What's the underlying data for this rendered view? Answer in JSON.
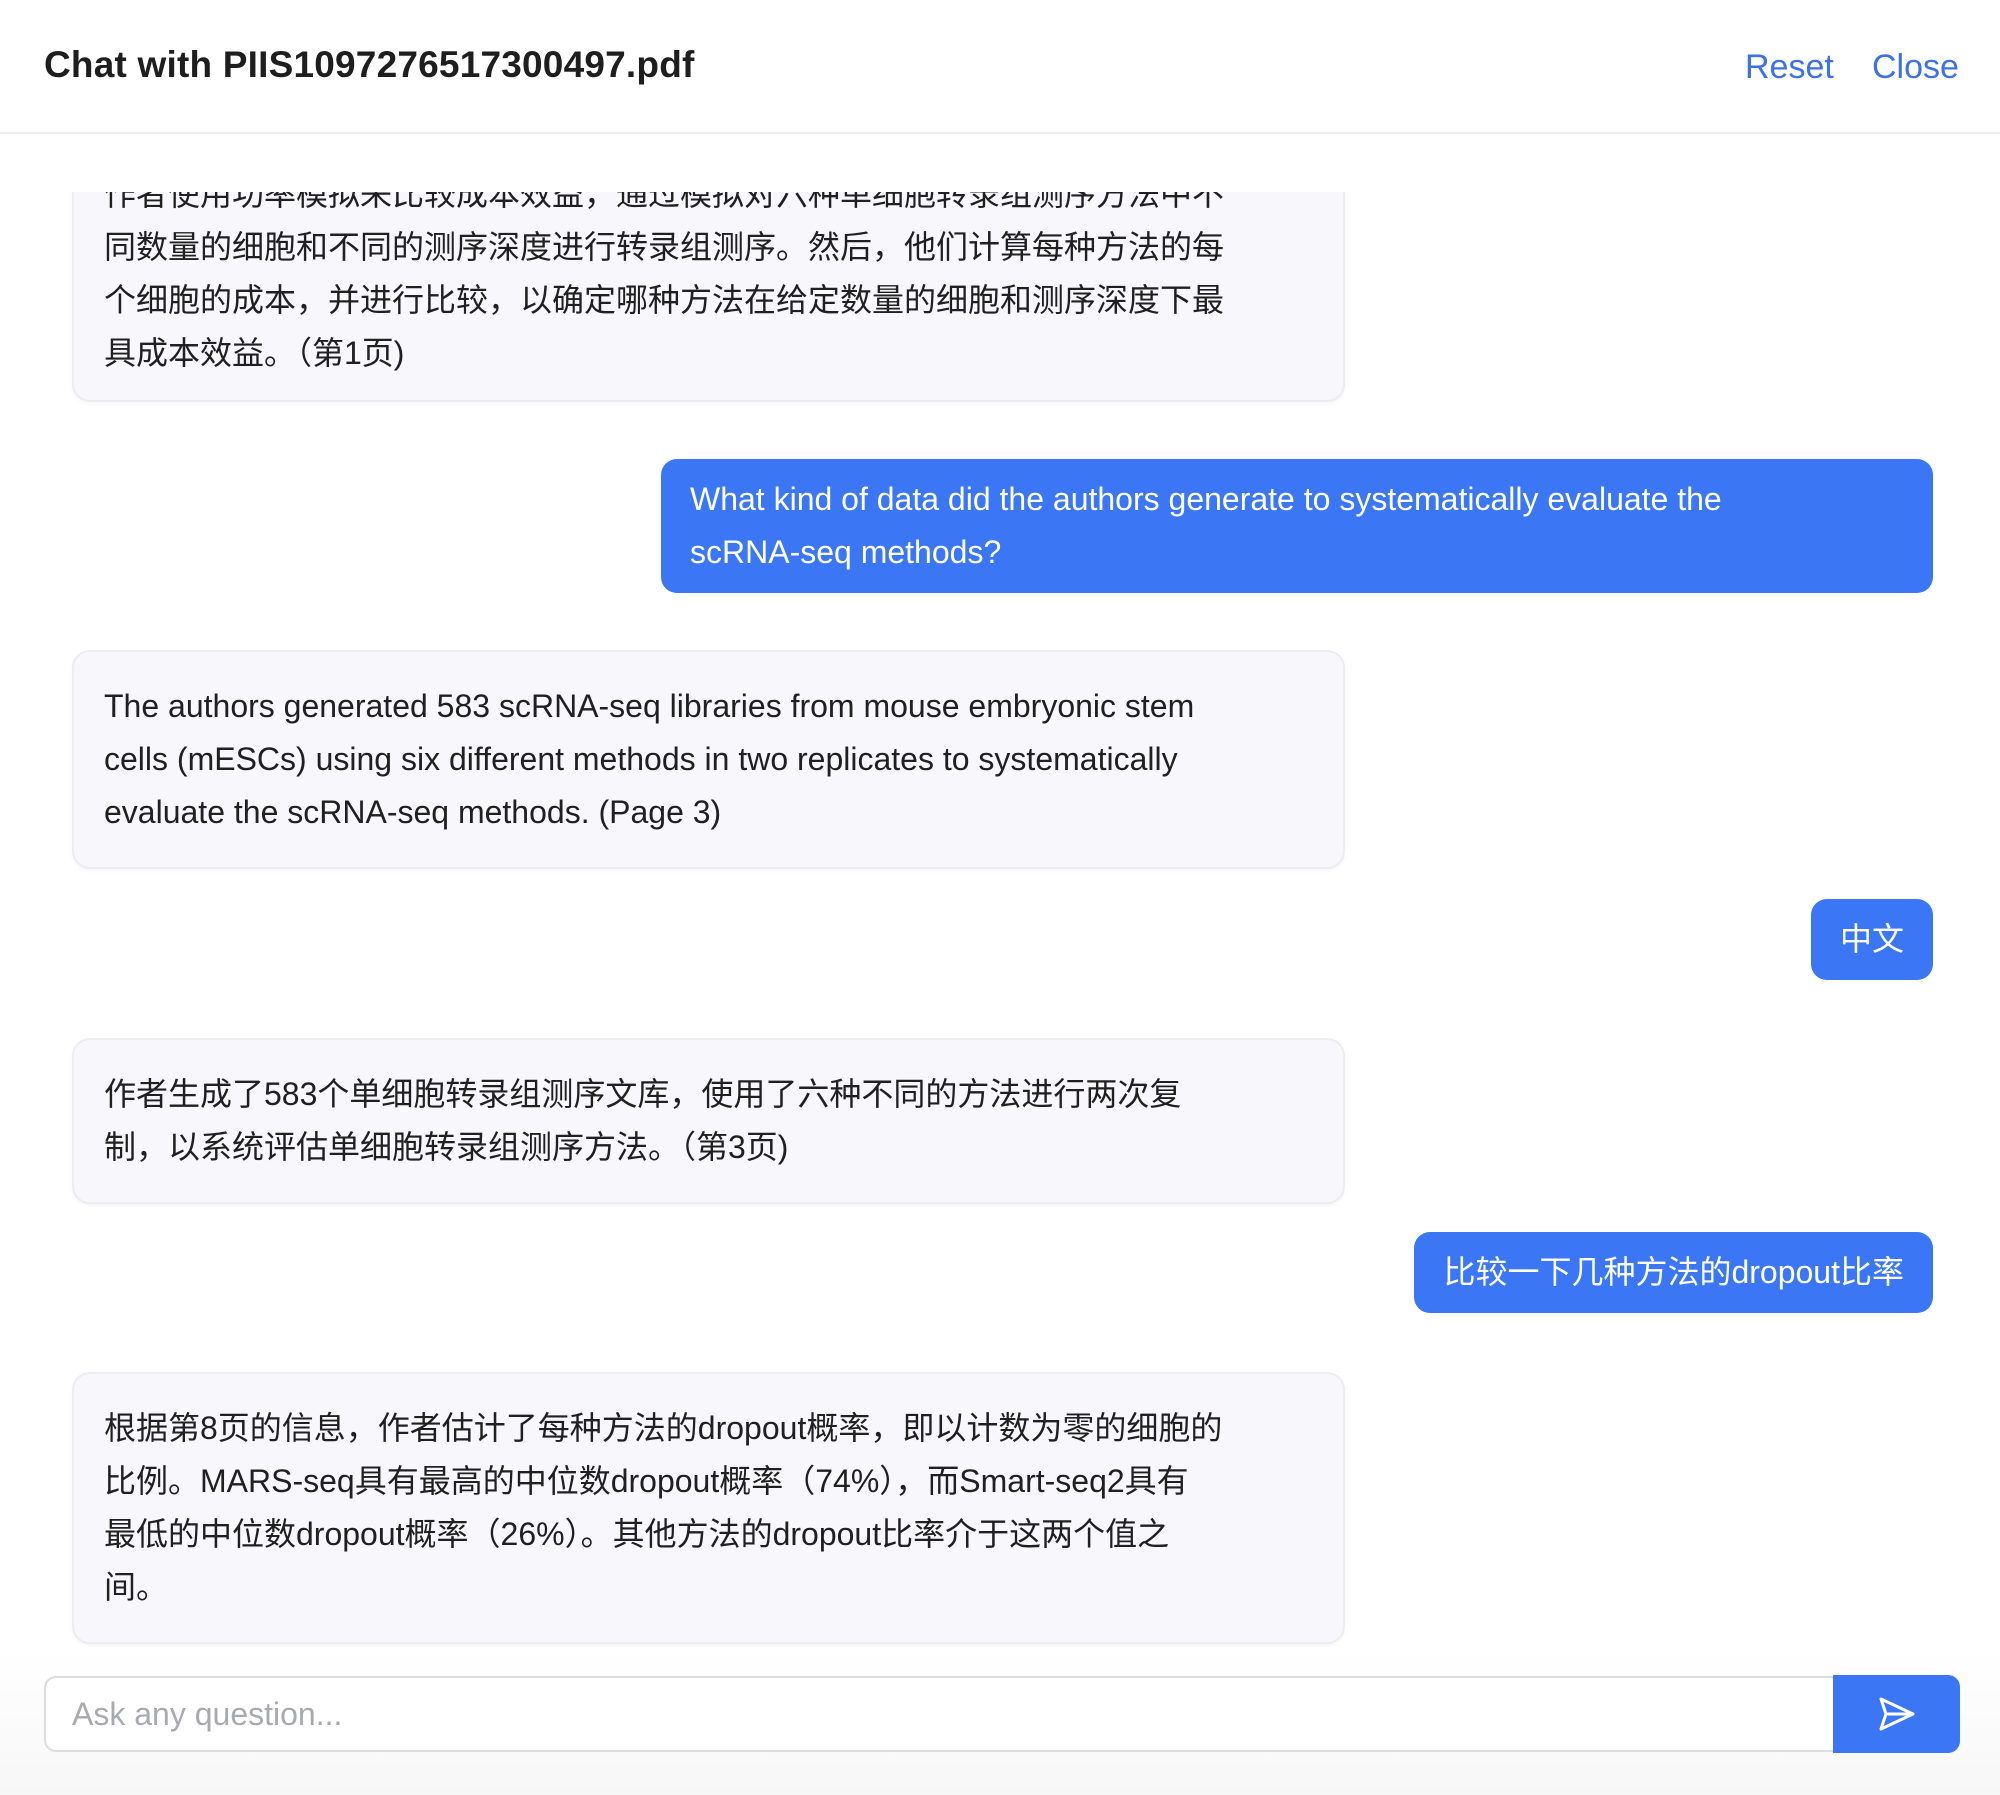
{
  "header": {
    "title": "Chat with PIIS1097276517300497.pdf",
    "reset_label": "Reset",
    "close_label": "Close"
  },
  "messages": [
    {
      "role": "assistant",
      "lines": [
        "作者使用功率模拟来比较成本效益，通过模拟对六种单细胞转录组测序方法中不",
        "同数量的细胞和不同的测序深度进行转录组测序。然后，他们计算每种方法的每",
        "个细胞的成本，并进行比较，以确定哪种方法在给定数量的细胞和测序深度下最",
        "具成本效益。（第1页)"
      ]
    },
    {
      "role": "user",
      "lines": [
        "What kind of data did the authors generate to systematically evaluate the",
        "scRNA-seq methods?"
      ]
    },
    {
      "role": "assistant",
      "lines": [
        "The authors generated 583 scRNA-seq libraries from mouse embryonic stem",
        "cells (mESCs) using six different methods in two replicates to systematically",
        "evaluate the scRNA-seq methods. (Page 3)"
      ]
    },
    {
      "role": "user",
      "lines": [
        "中文"
      ]
    },
    {
      "role": "assistant",
      "lines": [
        "作者生成了583个单细胞转录组测序文库，使用了六种不同的方法进行两次复",
        "制，以系统评估单细胞转录组测序方法。（第3页)"
      ]
    },
    {
      "role": "user",
      "lines": [
        "比较一下几种方法的dropout比率"
      ]
    },
    {
      "role": "assistant",
      "lines": [
        "根据第8页的信息，作者估计了每种方法的dropout概率，即以计数为零的细胞的",
        "比例。MARS-seq具有最高的中位数dropout概率（74%），而Smart-seq2具有",
        "最低的中位数dropout概率（26%）。其他方法的dropout比率介于这两个值之",
        "间。"
      ]
    }
  ],
  "composer": {
    "placeholder": "Ask any question...",
    "value": "",
    "send_icon": "send-icon"
  },
  "colors": {
    "accent": "#3b76f4",
    "link": "#3b72e8",
    "bot_bubble": "#f8f8fc"
  }
}
